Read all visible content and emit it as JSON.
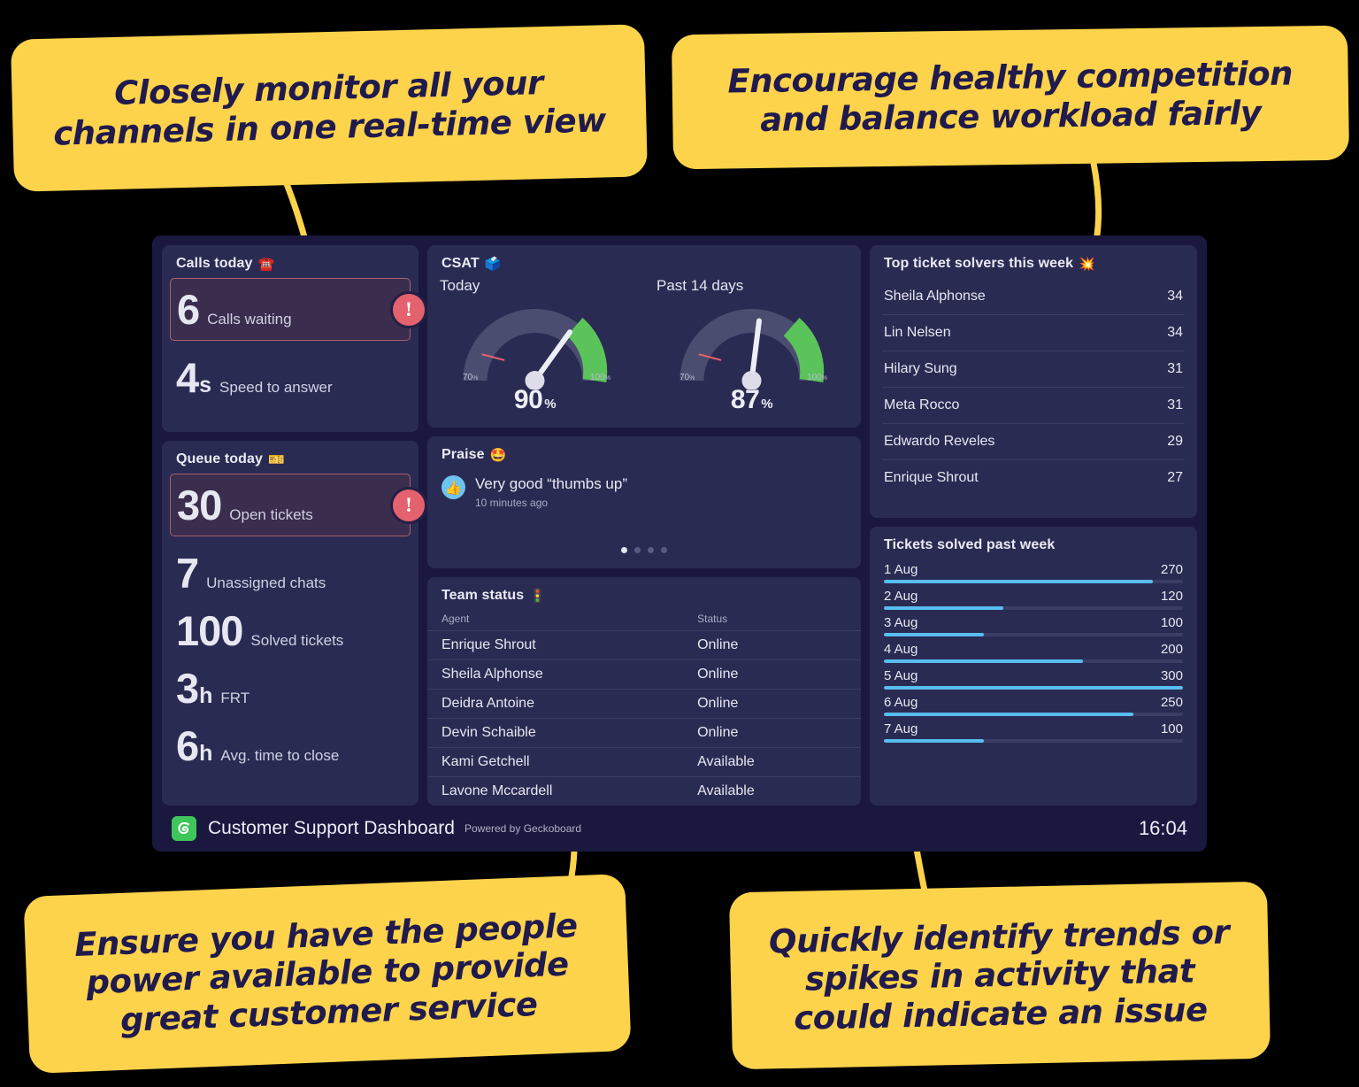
{
  "callouts": [
    {
      "id": "tl",
      "text": "Closely monitor all your channels in one real-time view"
    },
    {
      "id": "tr",
      "text": "Encourage healthy competition and balance workload fairly"
    },
    {
      "id": "bl",
      "text": "Ensure you have the people power available to provide great customer service"
    },
    {
      "id": "br",
      "text": "Quickly identify trends or spikes in activity that could indicate an issue"
    }
  ],
  "calls_today": {
    "title": "Calls today",
    "icon": "telephone-emoji",
    "alert_metric": {
      "value": "6",
      "unit": "",
      "label": "Calls waiting",
      "alert": "!"
    },
    "metrics": [
      {
        "value": "4",
        "unit": "s",
        "label": "Speed to answer"
      }
    ]
  },
  "queue_today": {
    "title": "Queue today",
    "icon": "ticket-emoji",
    "alert_metric": {
      "value": "30",
      "unit": "",
      "label": "Open tickets",
      "alert": "!"
    },
    "metrics": [
      {
        "value": "7",
        "unit": "",
        "label": "Unassigned chats"
      },
      {
        "value": "100",
        "unit": "",
        "label": "Solved tickets"
      },
      {
        "value": "3",
        "unit": "h",
        "label": "FRT"
      },
      {
        "value": "6",
        "unit": "h",
        "label": "Avg. time to close"
      }
    ]
  },
  "csat": {
    "title": "CSAT",
    "icon": "ballot-box-emoji",
    "gauges": [
      {
        "caption": "Today",
        "value": "90",
        "suffix": "%",
        "min_label": "70",
        "max_label": "100",
        "pct_unit": "%"
      },
      {
        "caption": "Past 14 days",
        "value": "87",
        "suffix": "%",
        "min_label": "70",
        "max_label": "100",
        "pct_unit": "%"
      }
    ]
  },
  "praise": {
    "title": "Praise",
    "icon": "star-struck-emoji",
    "item": {
      "text": "Very good “thumbs up”",
      "time": "10 minutes ago",
      "icon": "thumbs-up-icon"
    },
    "dots": 4,
    "active_dot": 0
  },
  "team_status": {
    "title": "Team status",
    "icon": "traffic-light-emoji",
    "columns": [
      "Agent",
      "Status"
    ],
    "rows": [
      {
        "agent": "Enrique Shrout",
        "status": "Online"
      },
      {
        "agent": "Sheila Alphonse",
        "status": "Online"
      },
      {
        "agent": "Deidra Antoine",
        "status": "Online"
      },
      {
        "agent": "Devin Schaible",
        "status": "Online"
      },
      {
        "agent": "Kami Getchell",
        "status": "Available"
      },
      {
        "agent": "Lavone Mccardell",
        "status": "Available"
      }
    ]
  },
  "top_solvers": {
    "title": "Top ticket solvers this week",
    "icon": "collision-emoji",
    "rows": [
      {
        "name": "Sheila Alphonse",
        "count": "34"
      },
      {
        "name": "Lin Nelsen",
        "count": "34"
      },
      {
        "name": "Hilary Sung",
        "count": "31"
      },
      {
        "name": "Meta Rocco",
        "count": "31"
      },
      {
        "name": "Edwardo Reveles",
        "count": "29"
      },
      {
        "name": "Enrique Shrout",
        "count": "27"
      }
    ]
  },
  "tickets_solved": {
    "title": "Tickets solved past week"
  },
  "footer": {
    "title": "Customer Support Dashboard",
    "subtitle": "Powered by Geckoboard",
    "clock": "16:04",
    "logo": "geckoboard-logo"
  },
  "colors": {
    "accent_yellow": "#FCD34B",
    "bar_blue": "#58bdf0",
    "gauge_green": "#5ac45a",
    "gauge_grey": "#4b4d70",
    "alert_red": "#e4616e",
    "tile_bg": "#2a2b52",
    "frame_bg": "#1b1840"
  },
  "chart_data": {
    "type": "bar",
    "title": "Tickets solved past week",
    "categories": [
      "1 Aug",
      "2 Aug",
      "3 Aug",
      "4 Aug",
      "5 Aug",
      "6 Aug",
      "7 Aug"
    ],
    "values": [
      270,
      120,
      100,
      200,
      300,
      250,
      100
    ],
    "xlabel": "",
    "ylabel": "Tickets solved",
    "xlim": [
      0,
      300
    ],
    "orientation": "horizontal",
    "grid": false,
    "legend": "none",
    "bar_color": "#58bdf0"
  },
  "gauge_data": [
    {
      "type": "gauge",
      "title": "Today",
      "value": 90,
      "min": 70,
      "max": 100,
      "target_marker": 77,
      "green_band": [
        85,
        100
      ],
      "unit": "%"
    },
    {
      "type": "gauge",
      "title": "Past 14 days",
      "value": 87,
      "min": 70,
      "max": 100,
      "target_marker": 77,
      "green_band": [
        85,
        100
      ],
      "unit": "%"
    }
  ]
}
